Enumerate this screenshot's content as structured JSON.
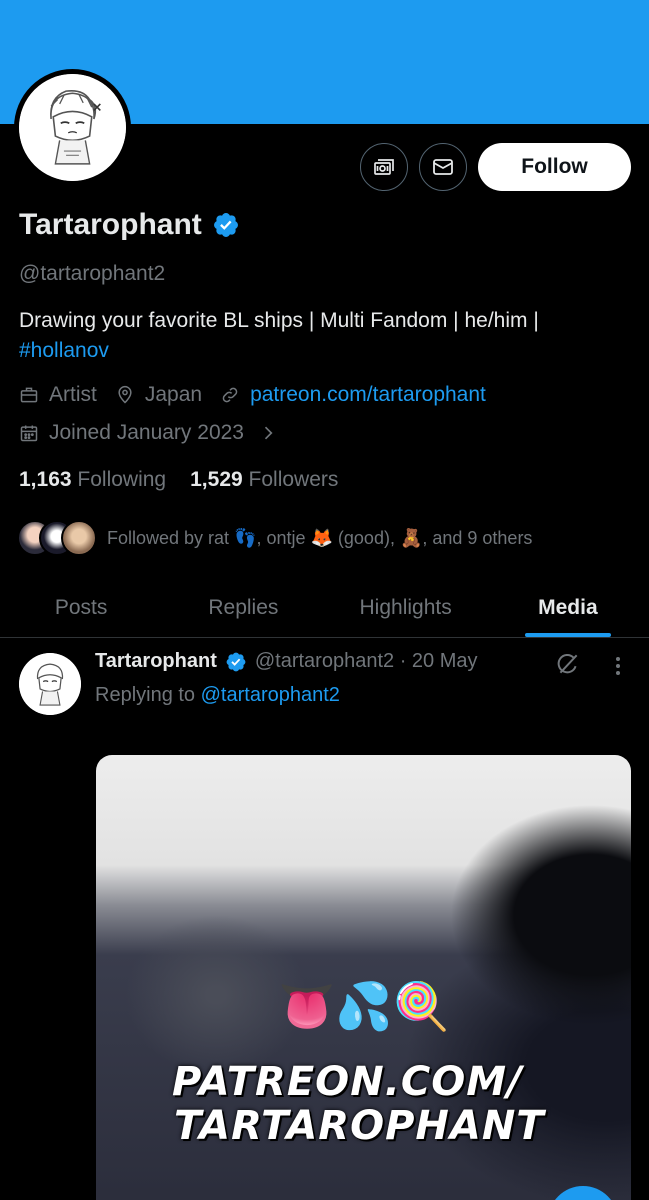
{
  "profile": {
    "name": "Tartarophant",
    "handle": "@tartarophant2",
    "bio_text": "Drawing your favorite BL ships | Multi Fandom | he/him |",
    "bio_hashtag": "#hollanov",
    "category": "Artist",
    "location": "Japan",
    "website": "patreon.com/tartarophant",
    "joined": "Joined January 2023",
    "following_count": "1,163",
    "following_label": "Following",
    "followers_count": "1,529",
    "followers_label": "Followers",
    "followed_by": "Followed by rat 👣, ontje 🦊 (good), 🧸, and 9 others"
  },
  "actions": {
    "follow_label": "Follow"
  },
  "tabs": [
    {
      "label": "Posts"
    },
    {
      "label": "Replies"
    },
    {
      "label": "Highlights"
    },
    {
      "label": "Media"
    }
  ],
  "post": {
    "author": "Tartarophant",
    "handle_date": "@tartarophant2 · 20 May",
    "replying_prefix": "Replying to",
    "replying_to": "@tartarophant2",
    "media_emojis": "👅💦🍭",
    "media_text_line1": "PATREON.COM/",
    "media_text_line2": "TARTAROPHANT"
  },
  "colors": {
    "accent": "#1d9bf0",
    "background": "#000000",
    "secondary_text": "#71767b"
  }
}
